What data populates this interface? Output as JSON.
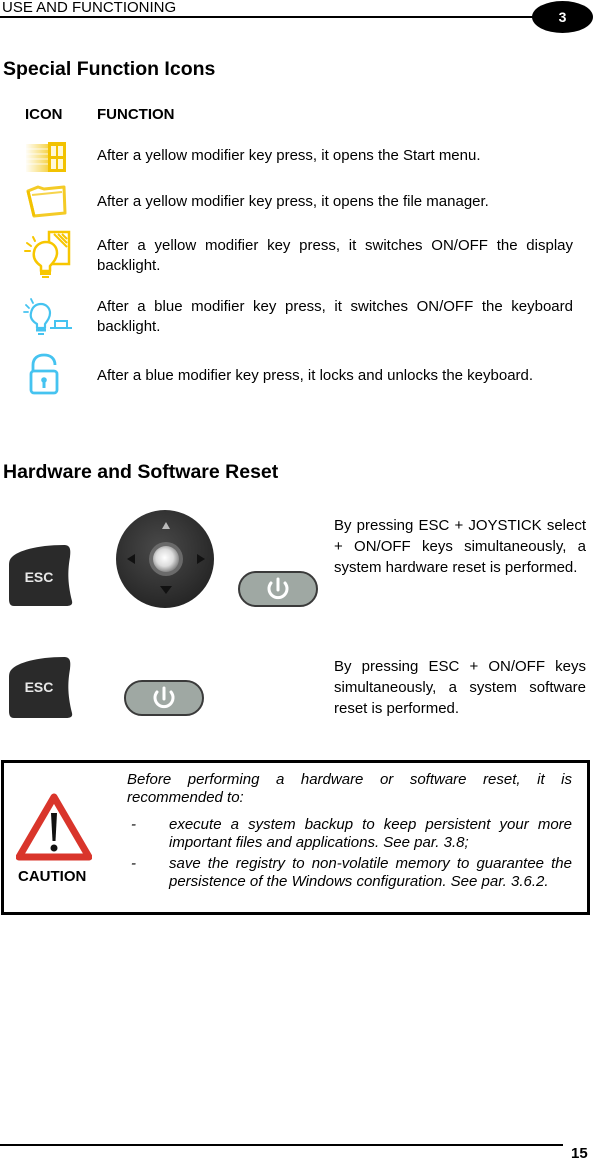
{
  "header": {
    "section_title": "USE AND FUNCTIONING",
    "chapter_number": "3"
  },
  "special_icons": {
    "title": "Special Function Icons",
    "col_icon": "ICON",
    "col_function": "FUNCTION",
    "rows": [
      {
        "icon": "windows-start-icon",
        "color": "#f2c200",
        "text": "After a yellow modifier key press, it opens the Start menu."
      },
      {
        "icon": "folder-icon",
        "color": "#f2c200",
        "text": "After a yellow modifier key press, it opens the file manager."
      },
      {
        "icon": "display-backlight-icon",
        "color": "#f7c600",
        "text": "After a yellow modifier key press, it switches ON/OFF the display backlight."
      },
      {
        "icon": "keyboard-backlight-icon",
        "color": "#45c3f0",
        "text": "After a blue modifier key press, it switches ON/OFF the keyboard backlight."
      },
      {
        "icon": "lock-icon",
        "color": "#45c3f0",
        "text": "After a blue modifier key press, it locks and unlocks the keyboard."
      }
    ]
  },
  "reset": {
    "title": "Hardware and Software Reset",
    "hardware_text": "By pressing ESC + JOYSTICK select + ON/OFF keys simultaneously, a system hardware reset is performed.",
    "software_text": "By pressing ESC + ON/OFF keys simultaneously, a system software reset is performed.",
    "esc_key_label": "ESC"
  },
  "caution": {
    "label": "CAUTION",
    "intro": "Before performing a hardware or software reset, it is recommended to:",
    "items": [
      {
        "bullet": "-",
        "text": "execute a system backup to keep persistent your more important files and applications. See par. 3.8;"
      },
      {
        "bullet": "-",
        "text": "save the registry to non-volatile memory to guarantee the persistence of the Windows configuration. See par. 3.6.2."
      }
    ]
  },
  "footer": {
    "page_number": "15"
  }
}
